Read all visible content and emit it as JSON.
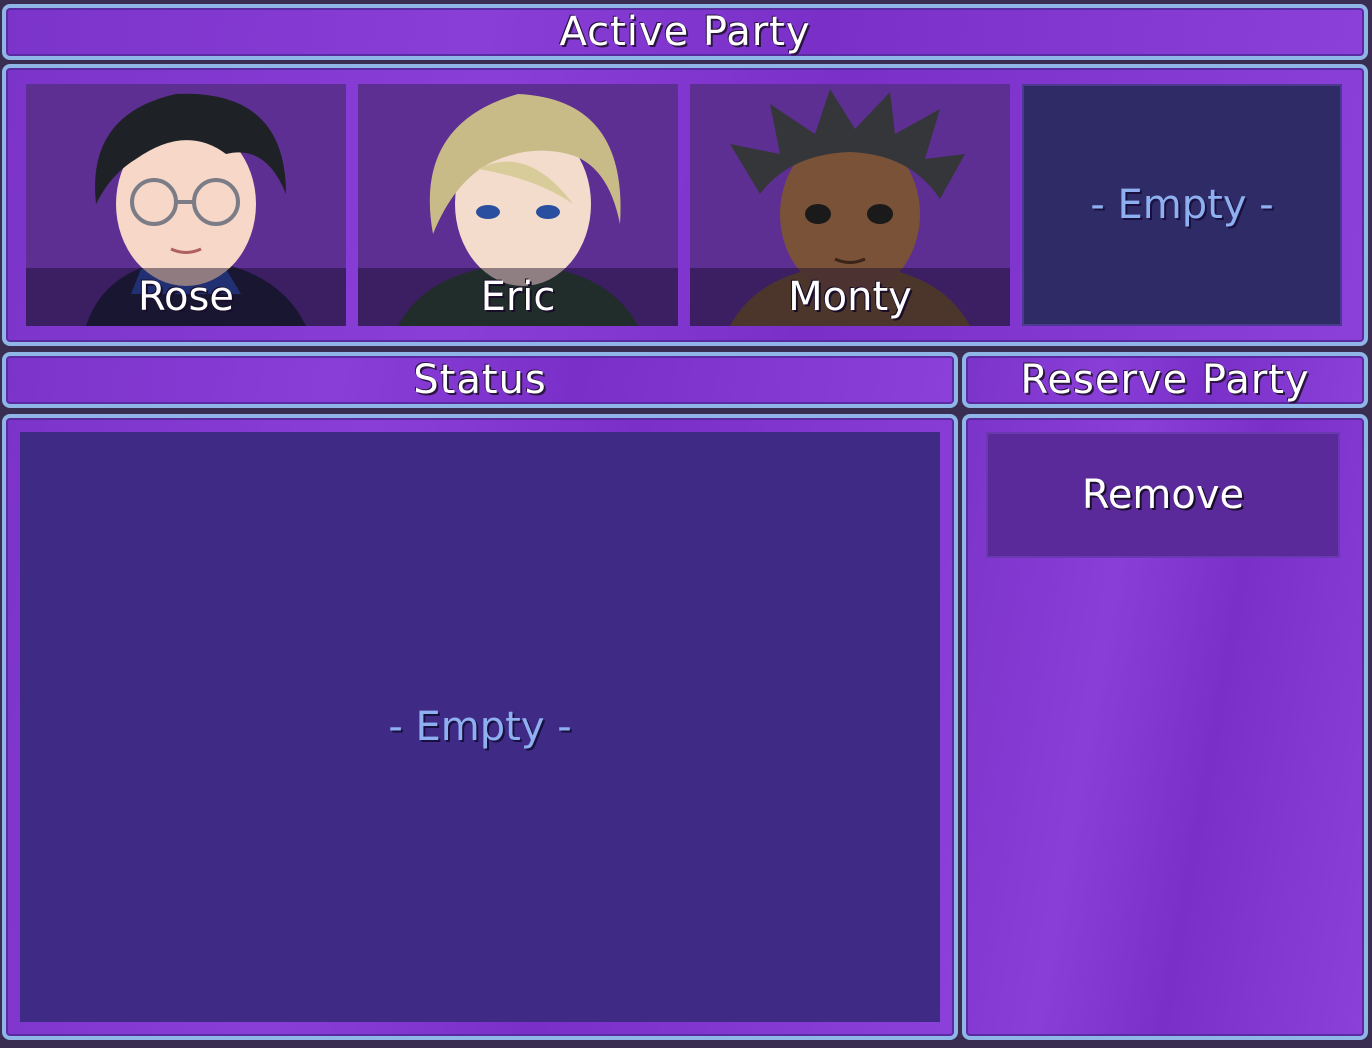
{
  "active_party": {
    "title": "Active Party",
    "members": [
      {
        "name": "Rose"
      },
      {
        "name": "Eric"
      },
      {
        "name": "Monty"
      }
    ],
    "empty_slot_label": "- Empty -"
  },
  "status": {
    "title": "Status",
    "empty_label": "- Empty -"
  },
  "reserve_party": {
    "title": "Reserve Party",
    "remove_label": "Remove"
  },
  "colors": {
    "window_fill": "#7b34c9",
    "window_border": "#8fb6e6",
    "empty_text": "#8fb0f0"
  }
}
